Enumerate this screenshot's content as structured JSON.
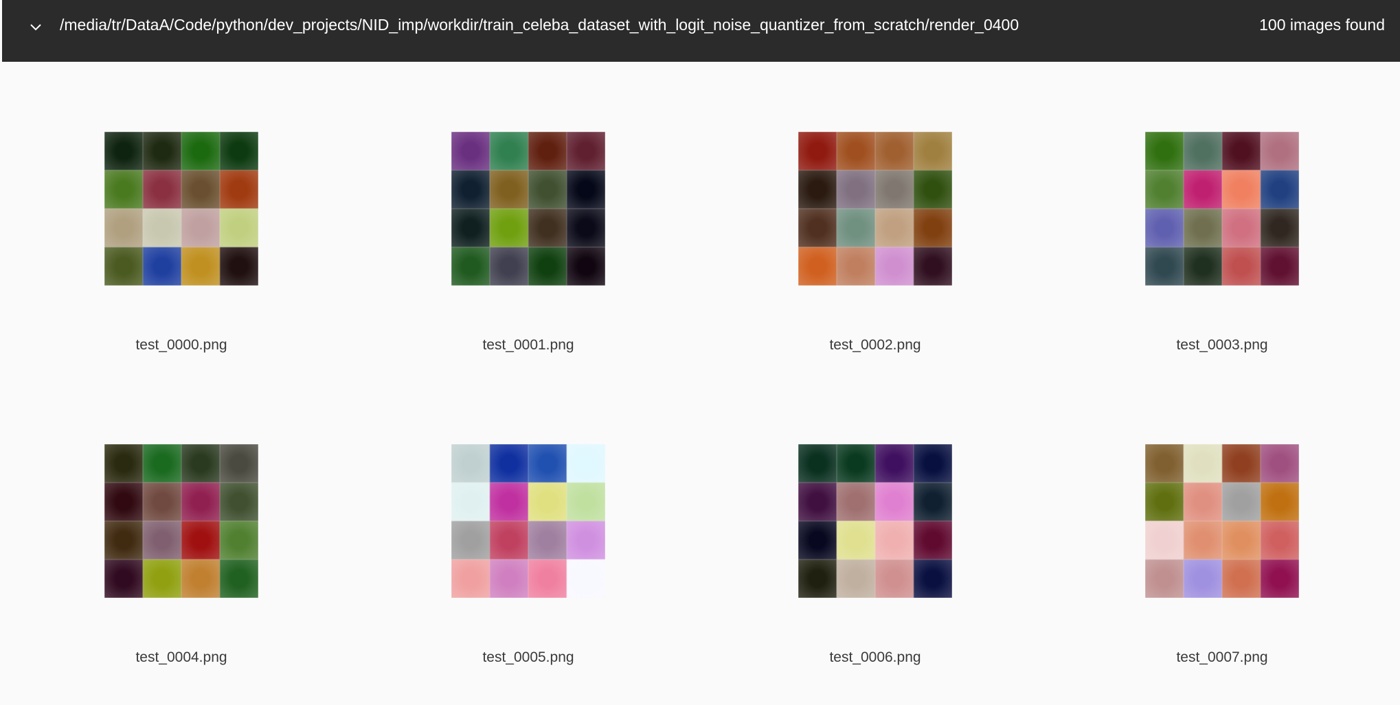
{
  "header": {
    "path": "/media/tr/DataA/Code/python/dev_projects/NID_imp/workdir/train_celeba_dataset_with_logit_noise_quantizer_from_scratch/render_0400",
    "count": "100 images found",
    "toggle_icon": "chevron-down-icon"
  },
  "images": [
    {
      "filename": "test_0000.png",
      "tiles": [
        "#0f2410",
        "#1f2a12",
        "#1c6a10",
        "#0d3a10",
        "#4a7a20",
        "#8a3040",
        "#6a5030",
        "#a03a10",
        "#b0a080",
        "#c8c8b0",
        "#c0a0a0",
        "#c0d080",
        "#4a5a20",
        "#2040a0",
        "#c09020",
        "#201010"
      ]
    },
    {
      "filename": "test_0001.png",
      "tiles": [
        "#6a3080",
        "#308050",
        "#602010",
        "#602030",
        "#102030",
        "#806020",
        "#405030",
        "#050818",
        "#102020",
        "#70a010",
        "#403020",
        "#0a0a18",
        "#205a20",
        "#404050",
        "#104010",
        "#100510"
      ]
    },
    {
      "filename": "test_0002.png",
      "tiles": [
        "#901a10",
        "#a05020",
        "#a06030",
        "#a08040",
        "#2a1a10",
        "#807080",
        "#807870",
        "#305010",
        "#503020",
        "#709080",
        "#c0a080",
        "#804010",
        "#d06020",
        "#c08060",
        "#d090d0",
        "#301020"
      ]
    },
    {
      "filename": "test_0003.png",
      "tiles": [
        "#307010",
        "#507060",
        "#501020",
        "#b07080",
        "#508030",
        "#c02070",
        "#f08060",
        "#204080",
        "#6060b0",
        "#707050",
        "#d07080",
        "#302820",
        "#304850",
        "#203020",
        "#c05050",
        "#601030"
      ]
    },
    {
      "filename": "test_0004.png",
      "tiles": [
        "#2a2a10",
        "#1a6a20",
        "#2a3a20",
        "#4a4a40",
        "#300a10",
        "#704a40",
        "#902050",
        "#405030",
        "#402a10",
        "#806070",
        "#a01010",
        "#508030",
        "#300a20",
        "#90a010",
        "#c08030",
        "#206020"
      ]
    },
    {
      "filename": "test_0005.png",
      "tiles": [
        "#c0d0d0",
        "#1030a0",
        "#2050b0",
        "#e0f8ff",
        "#e0f0f0",
        "#c030a0",
        "#e0e080",
        "#c0e0a0",
        "#a0a0a0",
        "#c04060",
        "#a080a0",
        "#d090e0",
        "#f0a0a0",
        "#d080c0",
        "#f080a0",
        "#f8f8ff"
      ]
    },
    {
      "filename": "test_0006.png",
      "tiles": [
        "#0a3020",
        "#0a3a20",
        "#401060",
        "#081040",
        "#401040",
        "#a07070",
        "#e080d0",
        "#102030",
        "#080820",
        "#e0e090",
        "#f0b0b0",
        "#600a30",
        "#202010",
        "#c0b0a0",
        "#d09090",
        "#0a1040"
      ]
    },
    {
      "filename": "test_0007.png",
      "tiles": [
        "#806030",
        "#e0e0c0",
        "#904020",
        "#a05080",
        "#607010",
        "#e09080",
        "#a0a0a0",
        "#c07010",
        "#f0d0d0",
        "#e09070",
        "#e09060",
        "#d06060",
        "#c09090",
        "#a090e0",
        "#d07050",
        "#901050"
      ]
    }
  ]
}
